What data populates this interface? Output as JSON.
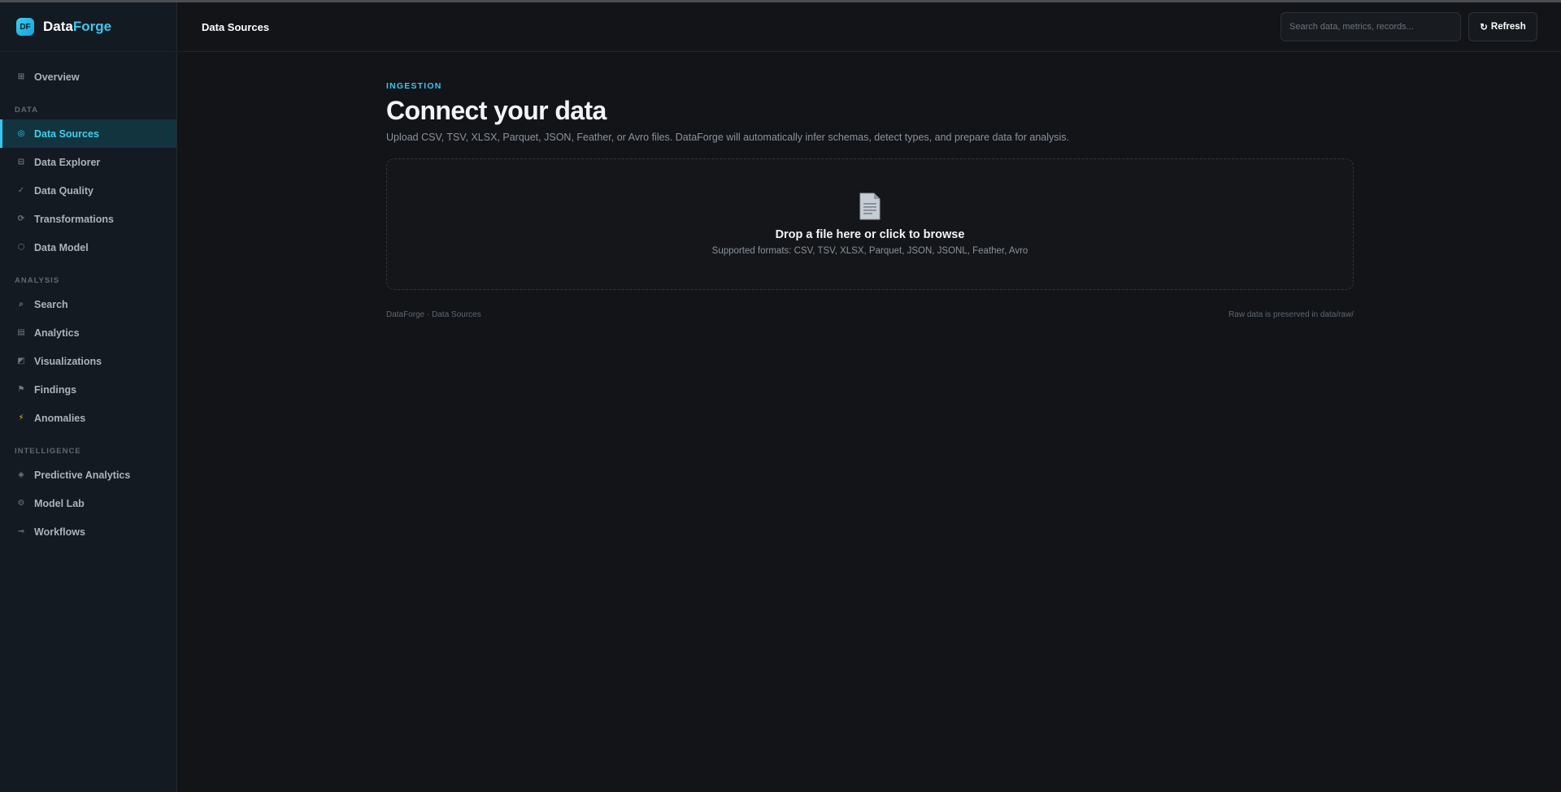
{
  "brand": {
    "logo_text": "DF",
    "name_part1": "Data",
    "name_part2": "Forge"
  },
  "sidebar": {
    "overview": {
      "label": "Overview",
      "icon": "grid-icon"
    },
    "sections": [
      {
        "title": "DATA",
        "items": [
          {
            "label": "Data Sources",
            "icon": "target-icon",
            "active": true
          },
          {
            "label": "Data Explorer",
            "icon": "table-icon"
          },
          {
            "label": "Data Quality",
            "icon": "check-icon"
          },
          {
            "label": "Transformations",
            "icon": "refresh-icon"
          },
          {
            "label": "Data Model",
            "icon": "hexagon-icon"
          }
        ]
      },
      {
        "title": "ANALYSIS",
        "items": [
          {
            "label": "Search",
            "icon": "search-icon"
          },
          {
            "label": "Analytics",
            "icon": "bars-icon"
          },
          {
            "label": "Visualizations",
            "icon": "chart-icon"
          },
          {
            "label": "Findings",
            "icon": "flag-icon"
          },
          {
            "label": "Anomalies",
            "icon": "lightning-icon"
          }
        ]
      },
      {
        "title": "INTELLIGENCE",
        "items": [
          {
            "label": "Predictive Analytics",
            "icon": "diamond-icon"
          },
          {
            "label": "Model Lab",
            "icon": "gear-icon"
          },
          {
            "label": "Workflows",
            "icon": "arrow-icon"
          }
        ]
      }
    ]
  },
  "header": {
    "title": "Data Sources",
    "search_placeholder": "Search data, metrics, records...",
    "refresh_label": "Refresh",
    "refresh_icon": "↻"
  },
  "main": {
    "eyebrow": "INGESTION",
    "title": "Connect your data",
    "subtitle": "Upload CSV, TSV, XLSX, Parquet, JSON, Feather, or Avro files. DataForge will automatically infer schemas, detect types, and prepare data for analysis.",
    "dropzone": {
      "title": "Drop a file here or click to browse",
      "subtitle": "Supported formats: CSV, TSV, XLSX, Parquet, JSON, JSONL, Feather, Avro",
      "icon": "document-icon"
    },
    "footer_left": "DataForge · Data Sources",
    "footer_right": "Raw data is preserved in data/raw/"
  },
  "colors": {
    "accent": "#38d0f5",
    "background": "#121418",
    "sidebar": "#141a22"
  }
}
